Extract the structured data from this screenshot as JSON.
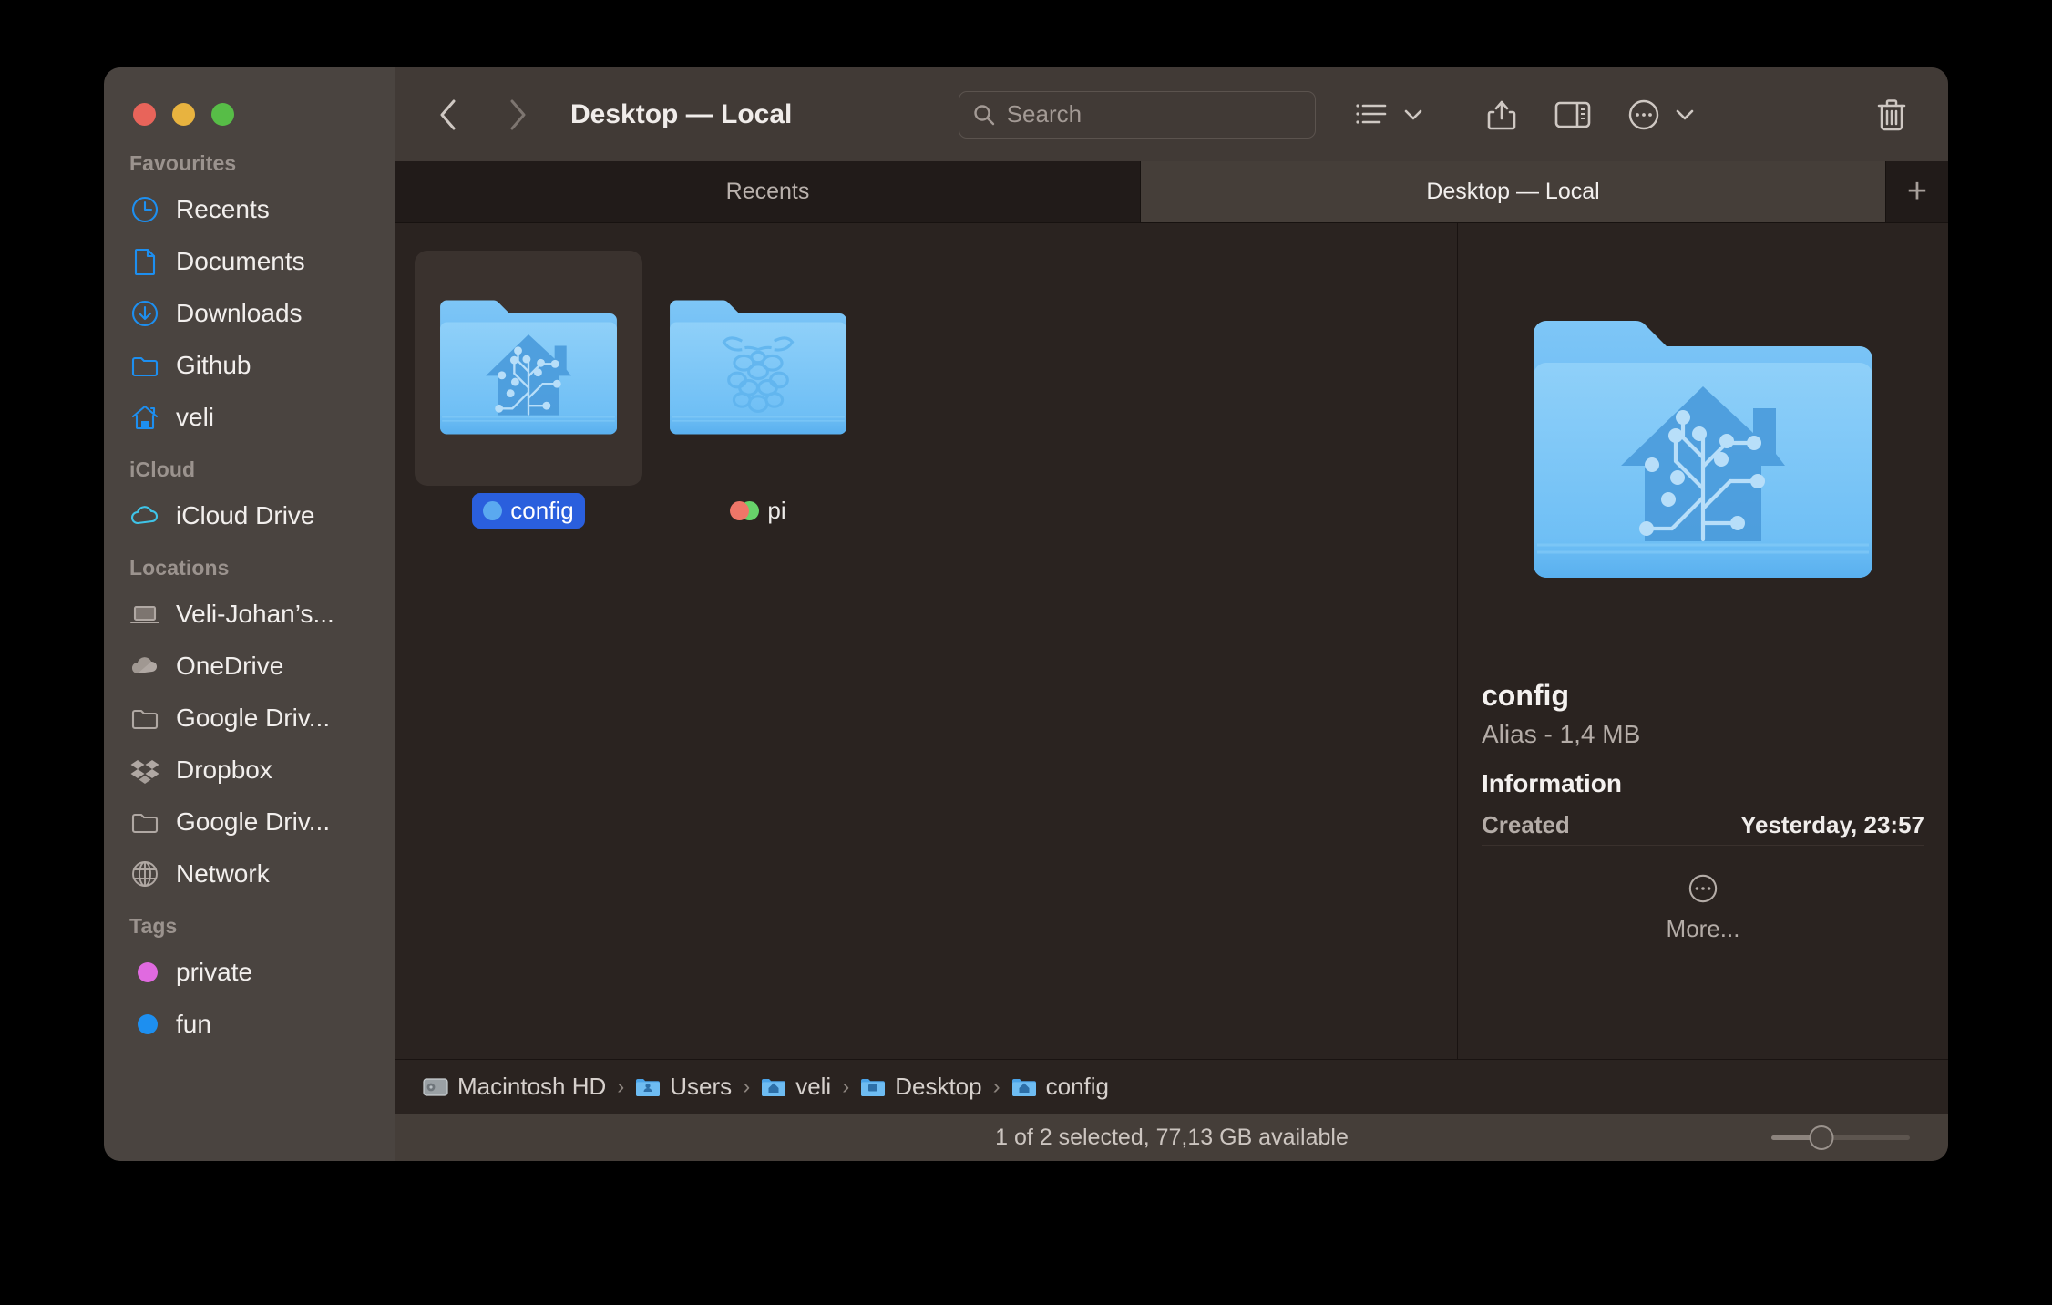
{
  "window": {
    "title": "Desktop — Local",
    "traffic_lights": [
      "close",
      "minimize",
      "maximize"
    ]
  },
  "toolbar": {
    "back_icon": "chevron-left-icon",
    "forward_icon": "chevron-right-icon",
    "search_placeholder": "Search",
    "search_value": "",
    "view_icon": "list-view-icon",
    "share_icon": "share-icon",
    "inspector_icon": "sidebar-panel-icon",
    "more_icon": "ellipsis-circle-icon",
    "trash_icon": "trash-icon"
  },
  "tabs": {
    "items": [
      {
        "label": "Recents",
        "active": false
      },
      {
        "label": "Desktop — Local",
        "active": true
      }
    ],
    "add_label": "+"
  },
  "sidebar": {
    "sections": [
      {
        "title": "Favourites",
        "items": [
          {
            "label": "Recents",
            "icon": "clock-icon"
          },
          {
            "label": "Documents",
            "icon": "document-icon"
          },
          {
            "label": "Downloads",
            "icon": "download-circle-icon"
          },
          {
            "label": "Github",
            "icon": "folder-icon"
          },
          {
            "label": "veli",
            "icon": "home-icon"
          }
        ]
      },
      {
        "title": "iCloud",
        "items": [
          {
            "label": "iCloud Drive",
            "icon": "cloud-icon"
          }
        ]
      },
      {
        "title": "Locations",
        "items": [
          {
            "label": "Veli-Johan’s...",
            "icon": "laptop-icon"
          },
          {
            "label": "OneDrive",
            "icon": "cloud-filled-icon"
          },
          {
            "label": "Google Driv...",
            "icon": "folder-icon"
          },
          {
            "label": "Dropbox",
            "icon": "dropbox-icon"
          },
          {
            "label": "Google Driv...",
            "icon": "folder-icon"
          },
          {
            "label": "Network",
            "icon": "globe-icon"
          }
        ]
      },
      {
        "title": "Tags",
        "items": [
          {
            "label": "private",
            "icon": "tag-dot-icon",
            "color": "#e06ae0"
          },
          {
            "label": "fun",
            "icon": "tag-dot-icon",
            "color": "#1d8ff0"
          }
        ]
      }
    ]
  },
  "files": [
    {
      "name": "config",
      "icon": "home-assistant-folder-icon",
      "selected": true,
      "tags": [
        {
          "color": "#5aa9f0"
        }
      ]
    },
    {
      "name": "pi",
      "icon": "raspberry-pi-folder-icon",
      "selected": false,
      "tags": [
        {
          "color": "#67d36a"
        },
        {
          "color": "#ef7668"
        }
      ]
    }
  ],
  "preview": {
    "icon": "home-assistant-folder-icon",
    "name": "config",
    "subtitle": "Alias - 1,4 MB",
    "section_title": "Information",
    "rows": [
      {
        "key": "Created",
        "value": "Yesterday, 23:57"
      }
    ],
    "more_label": "More...",
    "more_icon": "ellipsis-circle-icon"
  },
  "path_bar": {
    "crumbs": [
      {
        "label": "Macintosh HD",
        "icon": "hard-drive-icon"
      },
      {
        "label": "Users",
        "icon": "users-folder-icon"
      },
      {
        "label": "veli",
        "icon": "home-folder-icon"
      },
      {
        "label": "Desktop",
        "icon": "desktop-folder-icon"
      },
      {
        "label": "config",
        "icon": "home-assistant-folder-icon"
      }
    ],
    "separator": "›"
  },
  "status_bar": {
    "text": "1 of 2 selected, 77,13 GB available",
    "zoom_value": 36
  },
  "colors": {
    "sidebar_bg": "#4a4440",
    "toolbar_bg": "#413a36",
    "content_bg": "#2a2320",
    "selection_blue": "#2a5fdd",
    "accent_blue": "#1d8ff0",
    "folder_blue": "#6ec1f5"
  }
}
